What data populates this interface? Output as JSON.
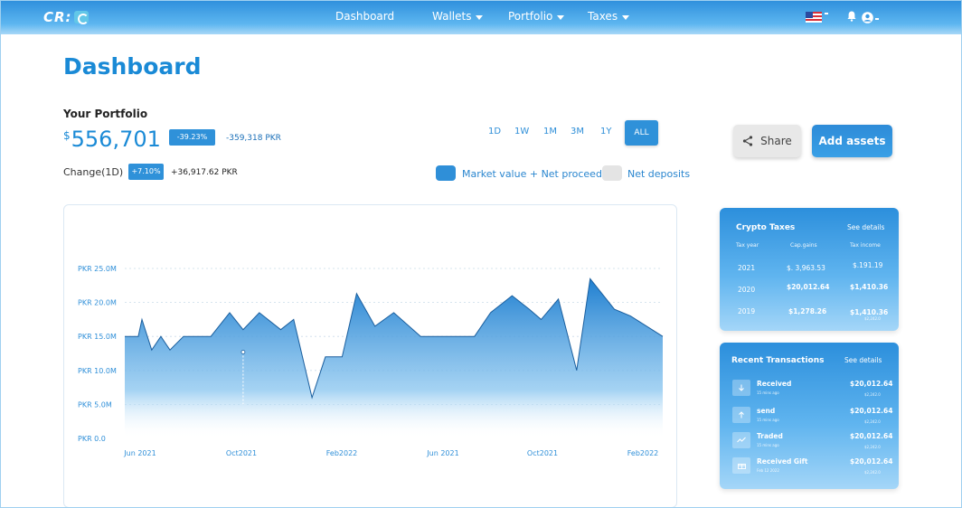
{
  "nav": {
    "logo": "CR:",
    "links": [
      "Dashboard",
      "Wallets",
      "Portfolio",
      "Taxes"
    ]
  },
  "page": {
    "title": "Dashboard"
  },
  "portfolio": {
    "label": "Your Portfolio",
    "currency_sign": "$",
    "value": "556,701",
    "change_pct": "-39.23%",
    "change_amount": "-359,318 PKR",
    "change_label": "Change(1D)",
    "change_1d_pct": "+7.10%",
    "change_1d_amount": "+36,917.62 PKR"
  },
  "time_filters": [
    "1D",
    "1W",
    "1M",
    "3M",
    "1Y",
    "ALL"
  ],
  "selected_filter": "ALL",
  "legend": {
    "market": "Market value + Net proceeds",
    "deposits": "Net deposits",
    "market_color": "#2f8fd8",
    "deposits_color": "#e4e4e4"
  },
  "buttons": {
    "share": "Share",
    "add_assets": "Add assets"
  },
  "chart_data": {
    "type": "area",
    "ytick_labels": [
      "PKR 0.0",
      "PKR 5.0M",
      "PKR 10.0M",
      "PKR 15.0M",
      "PKR 20.0M",
      "PKR 25.0M"
    ],
    "xtick_labels": [
      "Jun 2021",
      "Oct2021",
      "Feb2022",
      "Jun 2021",
      "Oct2021",
      "Feb2022"
    ],
    "ylim": [
      0,
      25
    ],
    "y_unit": "M PKR",
    "x_domain": [
      0,
      100
    ],
    "x": [
      0,
      2.5,
      3.2,
      5,
      6.7,
      8.4,
      10.9,
      16,
      19.5,
      22,
      25,
      29,
      31.4,
      34.8,
      37.3,
      40.4,
      43.1,
      46.5,
      50,
      55,
      61,
      65,
      68,
      72,
      75.2,
      77.4,
      80.6,
      84,
      86.5,
      91,
      94,
      100
    ],
    "y": [
      15,
      15,
      17.5,
      13,
      15,
      13,
      15,
      15,
      18.5,
      16,
      18.5,
      16,
      17.5,
      6,
      12,
      12,
      21.3,
      16.5,
      18.5,
      15,
      15,
      15,
      18.5,
      21,
      19,
      17.5,
      20.5,
      10,
      23.5,
      19,
      18,
      15
    ],
    "marker": {
      "x": 22,
      "y": 12.7
    },
    "grid": true
  },
  "crypto_taxes": {
    "title": "Crypto Taxes",
    "link": "See details",
    "headers": [
      "Tax year",
      "Cap.gains",
      "Tax income"
    ],
    "rows": [
      {
        "year": "2021",
        "gains": "$. 3,963.53",
        "income": "$.191.19",
        "sub": ""
      },
      {
        "year": "2020",
        "gains": "$20,012.64",
        "income": "$1,410.36",
        "sub": ""
      },
      {
        "year": "2019",
        "gains": "$1,278.26",
        "income": "$1,410.36",
        "sub": "$2,242.0"
      }
    ]
  },
  "transactions": {
    "title": "Recent Transactions",
    "link": "See details",
    "items": [
      {
        "name": "Received",
        "time": "15 mins ago",
        "amount": "$20,012.64",
        "sub": "$2,242.0",
        "icon": "arrow-down-icon"
      },
      {
        "name": "send",
        "time": "15 mins ago",
        "amount": "$20,012.64",
        "sub": "$2,242.0",
        "icon": "arrow-up-icon"
      },
      {
        "name": "Traded",
        "time": "15 mins ago",
        "amount": "$20,012.64",
        "sub": "$2,242.0",
        "icon": "trade-icon"
      },
      {
        "name": "Received Gift",
        "time": "Feb 12 2022",
        "amount": "$20,012.64",
        "sub": "$2,242.0",
        "icon": "gift-icon"
      }
    ]
  }
}
